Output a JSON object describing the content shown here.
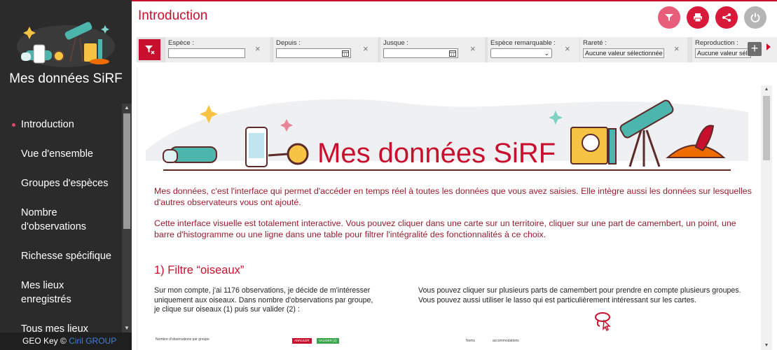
{
  "app": {
    "title": "Mes données SiRF",
    "footer_text": "GEO Key",
    "footer_copyright": "©",
    "footer_brand": "Ciril GROUP",
    "accent_color": "#c8102e",
    "sidebar_color": "#2b2b2b"
  },
  "sidebar": {
    "items": [
      {
        "label": "Introduction",
        "active": true
      },
      {
        "label": "Vue d'ensemble",
        "active": false
      },
      {
        "label": "Groupes d'espèces",
        "active": false
      },
      {
        "label": "Nombre d'observations",
        "active": false
      },
      {
        "label": "Richesse spécifique",
        "active": false
      },
      {
        "label": "Mes lieux enregistrés",
        "active": false
      },
      {
        "label": "Tous mes lieux",
        "active": false
      }
    ]
  },
  "header": {
    "page_title": "Introduction",
    "actions": [
      "filter-icon",
      "print-icon",
      "share-icon",
      "power-icon"
    ]
  },
  "filters": {
    "espece": {
      "label": "Espèce :",
      "value": ""
    },
    "depuis": {
      "label": "Depuis :",
      "value": ""
    },
    "jusque": {
      "label": "Jusque :",
      "value": ""
    },
    "espece_remarquable": {
      "label": "Espèce remarquable :",
      "value": ""
    },
    "rarete": {
      "label": "Rareté :",
      "value": "Aucune valeur sélectionnée"
    },
    "reproduction": {
      "label": "Reproduction :",
      "value": "Aucune valeur sélectionnée"
    }
  },
  "content": {
    "banner_title": "Mes données SiRF",
    "intro_p1": "Mes données, c'est l'interface qui permet d'accéder en temps réel à toutes les données que vous avez saisies. Elle intègre aussi les données sur lesquelles d'autres observateurs vous ont ajouté.",
    "intro_p2": "Cette interface visuelle est totalement interactive. Vous pouvez cliquer dans une carte sur un territoire, cliquer sur une part de camembert, un point, une barre d'histogramme ou une ligne dans une table pour filtrer l'intégralité des fonctionnalités à ce choix.",
    "section1_title": "1) Filtre “oiseaux”",
    "section1_left": "Sur mon compte, j'ai 1176 observations, je décide de m'intéresser uniquement aux oiseaux. Dans nombre d'observations par groupe, je clique sur oiseaux (1) puis sur valider (2) :",
    "section1_right": "Vous pouvez cliquer sur plusieurs parts de camembert pour prendre en compte plusieurs groupes. Vous pouvez aussi utiliser le lasso qui est particulièrement intéressant sur les cartes.",
    "mini_chart_title": "Nombre d'observations par groupe",
    "mini_cancel": "ANNULER",
    "mini_validate": "VALIDER (2)",
    "mini_right_label1": "Noms",
    "mini_right_label2": "accommodations"
  }
}
